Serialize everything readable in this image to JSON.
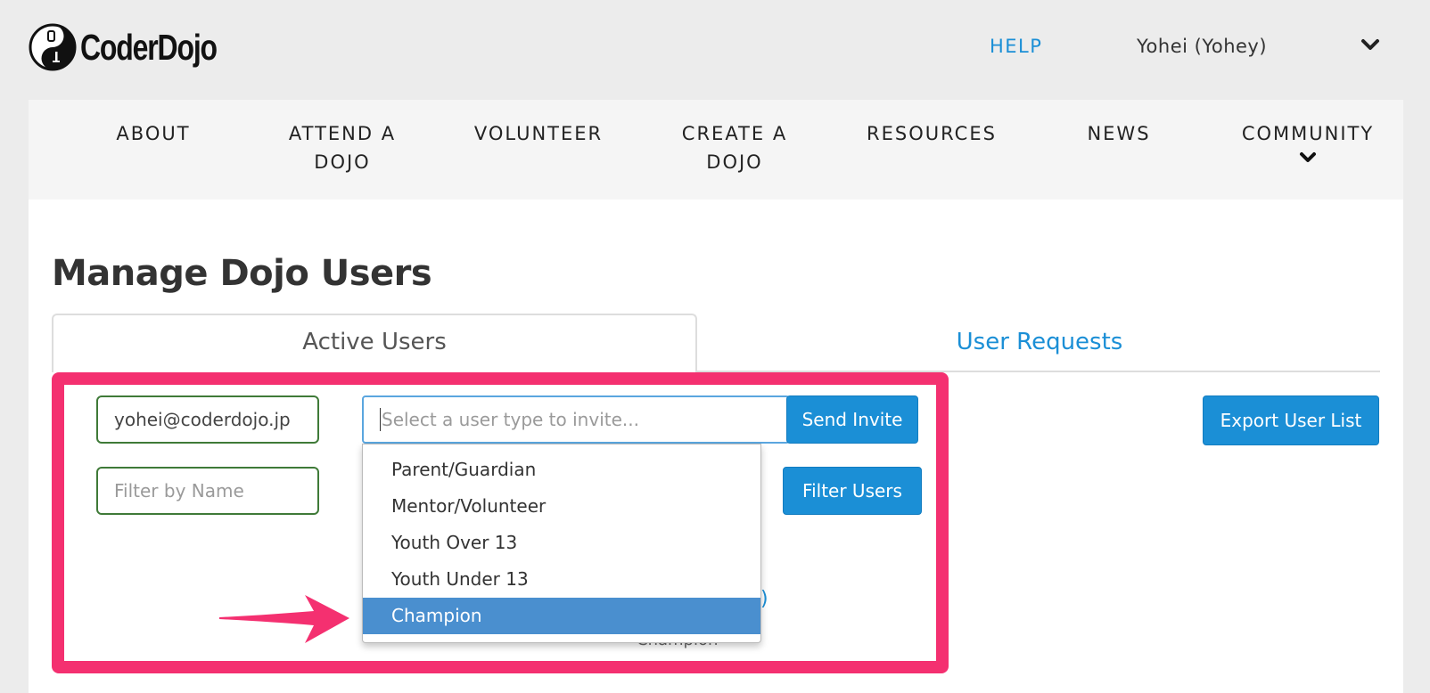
{
  "header": {
    "logo_text": "CoderDojo",
    "help_label": "HELP",
    "user_name": "Yohei (Yohey)"
  },
  "nav": {
    "items": [
      {
        "line1": "ABOUT",
        "line2": ""
      },
      {
        "line1": "ATTEND A",
        "line2": "DOJO"
      },
      {
        "line1": "VOLUNTEER",
        "line2": ""
      },
      {
        "line1": "CREATE A",
        "line2": "DOJO"
      },
      {
        "line1": "RESOURCES",
        "line2": ""
      },
      {
        "line1": "NEWS",
        "line2": ""
      },
      {
        "line1": "COMMUNITY",
        "line2": ""
      }
    ]
  },
  "page": {
    "title": "Manage Dojo Users"
  },
  "tabs": {
    "active": "Active Users",
    "requests": "User Requests"
  },
  "invite": {
    "email_value": "yohei@coderdojo.jp",
    "user_type_placeholder": "Select a user type to invite...",
    "send_label": "Send Invite",
    "export_label": "Export User List"
  },
  "filter": {
    "name_placeholder": "Filter by Name",
    "button_label": "Filter Users"
  },
  "dropdown": {
    "options": [
      "Parent/Guardian",
      "Mentor/Volunteer",
      "Youth Over 13",
      "Youth Under 13",
      "Champion"
    ],
    "selected": "Champion"
  },
  "behind": {
    "link_fragment": "y)",
    "role_text": "Champion"
  },
  "colors": {
    "accent": "#1b8fd6",
    "highlight": "#f43070",
    "selected_option": "#4a8fcf"
  },
  "icons": [
    "coderdojo-logo-icon",
    "chevron-down-icon",
    "annotation-arrow-icon"
  ]
}
